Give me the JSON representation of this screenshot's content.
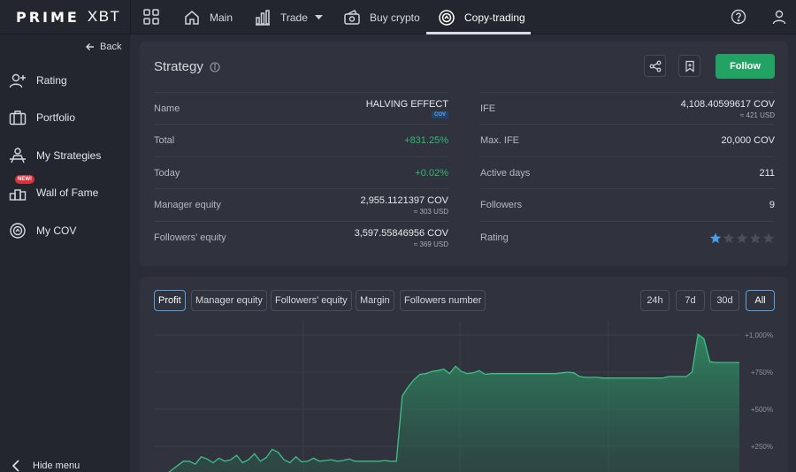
{
  "header": {
    "logo_prime": "PRIME",
    "logo_xbt": "XBT",
    "nav": [
      {
        "label": "Main",
        "icon": "home-icon"
      },
      {
        "label": "Trade",
        "icon": "bar-chart-icon"
      },
      {
        "label": "Buy crypto",
        "icon": "wallet-icon"
      },
      {
        "label": "Copy-trading",
        "icon": "copy-trading-icon"
      }
    ],
    "active_nav": "Copy-trading"
  },
  "sidebar": {
    "back_label": "Back",
    "items": [
      {
        "label": "Rating",
        "icon": "user-plus-icon"
      },
      {
        "label": "Portfolio",
        "icon": "briefcase-icon"
      },
      {
        "label": "My Strategies",
        "icon": "strategies-icon"
      },
      {
        "label": "Wall of Fame",
        "icon": "podium-icon",
        "badge": "NEW!"
      },
      {
        "label": "My COV",
        "icon": "cov-icon"
      }
    ],
    "hide_label": "Hide menu"
  },
  "strategy": {
    "title": "Strategy",
    "follow_label": "Follow",
    "left_rows": [
      {
        "label": "Name",
        "value": "HALVING EFFECT",
        "badge": "COV"
      },
      {
        "label": "Total",
        "value": "+831.25%",
        "positive": true
      },
      {
        "label": "Today",
        "value": "+0.02%",
        "positive": true
      },
      {
        "label": "Manager equity",
        "value": "2,955.1121397 COV",
        "sub": "≈ 303 USD"
      },
      {
        "label": "Followers' equity",
        "value": "3,597.55846956 COV",
        "sub": "≈ 369 USD"
      }
    ],
    "right_rows": [
      {
        "label": "IFE",
        "value": "4,108.40599617 COV",
        "sub": "≈ 421 USD"
      },
      {
        "label": "Max. IFE",
        "value": "20,000 COV"
      },
      {
        "label": "Active days",
        "value": "211"
      },
      {
        "label": "Followers",
        "value": "9"
      },
      {
        "label": "Rating",
        "stars": 1,
        "max_stars": 5
      }
    ]
  },
  "chart": {
    "tabs": [
      "Profit",
      "Manager equity",
      "Followers' equity",
      "Margin",
      "Followers number"
    ],
    "active_tab": "Profit",
    "ranges": [
      "24h",
      "7d",
      "30d",
      "All"
    ],
    "active_range": "All"
  },
  "colors": {
    "accent_green": "#23a363",
    "positive": "#2fb873",
    "active_border": "#5a9fe0",
    "star_filled": "#4a9ee8",
    "line": "#3fbf85"
  },
  "chart_data": {
    "type": "area",
    "title": "",
    "xlabel": "",
    "ylabel": "",
    "y_ticks": [
      "+1,000%",
      "+750%",
      "+500%",
      "+250%"
    ],
    "y_tick_values": [
      1000,
      750,
      500,
      250
    ],
    "ylim": [
      0,
      1100
    ],
    "grid": true,
    "x": [
      0,
      1,
      2,
      3,
      4,
      5,
      6,
      7,
      8,
      9,
      10,
      11,
      12,
      13,
      14,
      15,
      16,
      17,
      18,
      19,
      20,
      21,
      22,
      23,
      24,
      25,
      26,
      27,
      28,
      29,
      30,
      31,
      32,
      33,
      34,
      35,
      36,
      37,
      38,
      39,
      40,
      41,
      42,
      43,
      44,
      45,
      46,
      47,
      48,
      49,
      50,
      51,
      52,
      53,
      54,
      55,
      56,
      57,
      58,
      59,
      60,
      61,
      62,
      63,
      64,
      65,
      66,
      67,
      68,
      69,
      70,
      71,
      72,
      73,
      74,
      75,
      76,
      77,
      78,
      79,
      80,
      81,
      82,
      83,
      84,
      85,
      86,
      87,
      88,
      89,
      90,
      91,
      92,
      93,
      94,
      95,
      96,
      97,
      98,
      99
    ],
    "series": [
      {
        "values": [
          0,
          30,
          60,
          90,
          120,
          150,
          150,
          130,
          180,
          165,
          140,
          170,
          150,
          160,
          190,
          140,
          160,
          200,
          150,
          175,
          230,
          210,
          160,
          140,
          180,
          145,
          150,
          170,
          150,
          155,
          160,
          150,
          155,
          165,
          150,
          150,
          150,
          150,
          150,
          155,
          150,
          150,
          590,
          650,
          700,
          735,
          740,
          755,
          760,
          770,
          740,
          790,
          755,
          740,
          745,
          760,
          735,
          740,
          740,
          740,
          740,
          740,
          740,
          740,
          740,
          740,
          740,
          740,
          740,
          745,
          750,
          745,
          720,
          715,
          715,
          715,
          710,
          710,
          710,
          710,
          710,
          710,
          710,
          710,
          710,
          710,
          710,
          720,
          720,
          720,
          720,
          750,
          1005,
          975,
          820,
          815,
          815,
          815,
          815,
          815
        ]
      }
    ]
  }
}
